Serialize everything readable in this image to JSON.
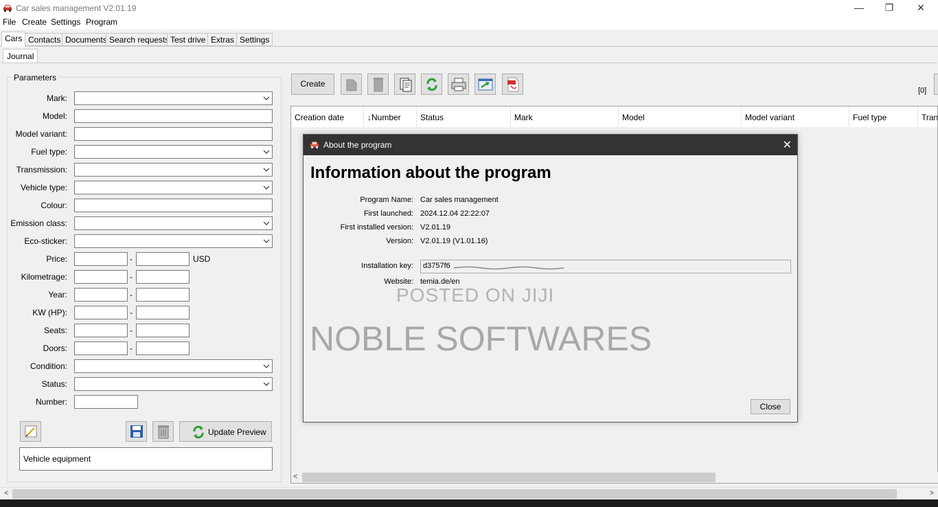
{
  "window": {
    "title": "Car sales management V2.01.19",
    "minimize": "—",
    "maximize": "❐",
    "close": "✕"
  },
  "menu": [
    "File",
    "Create",
    "Settings",
    "Program"
  ],
  "tabs": [
    "Cars",
    "Contacts",
    "Documents",
    "Search requests",
    "Test drive",
    "Extras",
    "Settings"
  ],
  "subtabs": [
    "Journal"
  ],
  "parameters": {
    "title": "Parameters",
    "mark": "Mark:",
    "model": "Model:",
    "model_variant": "Model variant:",
    "fuel_type": "Fuel type:",
    "transmission": "Transmission:",
    "vehicle_type": "Vehicle type:",
    "colour": "Colour:",
    "emission_class": "Emission class:",
    "eco_sticker": "Eco-sticker:",
    "price": "Price:",
    "kilometrage": "Kilometrage:",
    "year": "Year:",
    "kw_hp": "KW (HP):",
    "seats": "Seats:",
    "doors": "Doors:",
    "condition": "Condition:",
    "status": "Status:",
    "number": "Number:",
    "currency": "USD",
    "dash": "-"
  },
  "buttons": {
    "update_preview": "Update Preview",
    "vehicle_equipment": "Vehicle equipment",
    "create": "Create"
  },
  "toolbar_icons": [
    "copy-doc-icon",
    "delete-icon",
    "document-icon",
    "refresh-icon",
    "print-icon",
    "export-icon",
    "pdf-icon"
  ],
  "record_count": "[0]",
  "grid_columns": [
    "Creation date",
    "↓Number",
    "Status",
    "Mark",
    "Model",
    "Model variant",
    "Fuel type",
    "Tran"
  ],
  "dialog": {
    "title": "About the program",
    "heading": "Information about the program",
    "program_name_label": "Program Name:",
    "program_name": "Car sales management",
    "first_launched_label": "First launched:",
    "first_launched": "2024.12.04 22:22:07",
    "first_installed_label": "First installed version:",
    "first_installed": "V2.01.19",
    "version_label": "Version:",
    "version": "V2.01.19 (V1.01.16)",
    "key_label": "Installation key:",
    "key": "d3757f6",
    "website_label": "Website:",
    "website": "temia.de/en",
    "watermark_small": "POSTED ON JIJI",
    "watermark_large": "NOBLE SOFTWARES",
    "close_button": "Close"
  },
  "colors": {
    "dialog_titlebar": "#333333",
    "refresh_green": "#2e9e3a",
    "pdf_red": "#d0312d",
    "window_bg": "#f0f0f0"
  }
}
